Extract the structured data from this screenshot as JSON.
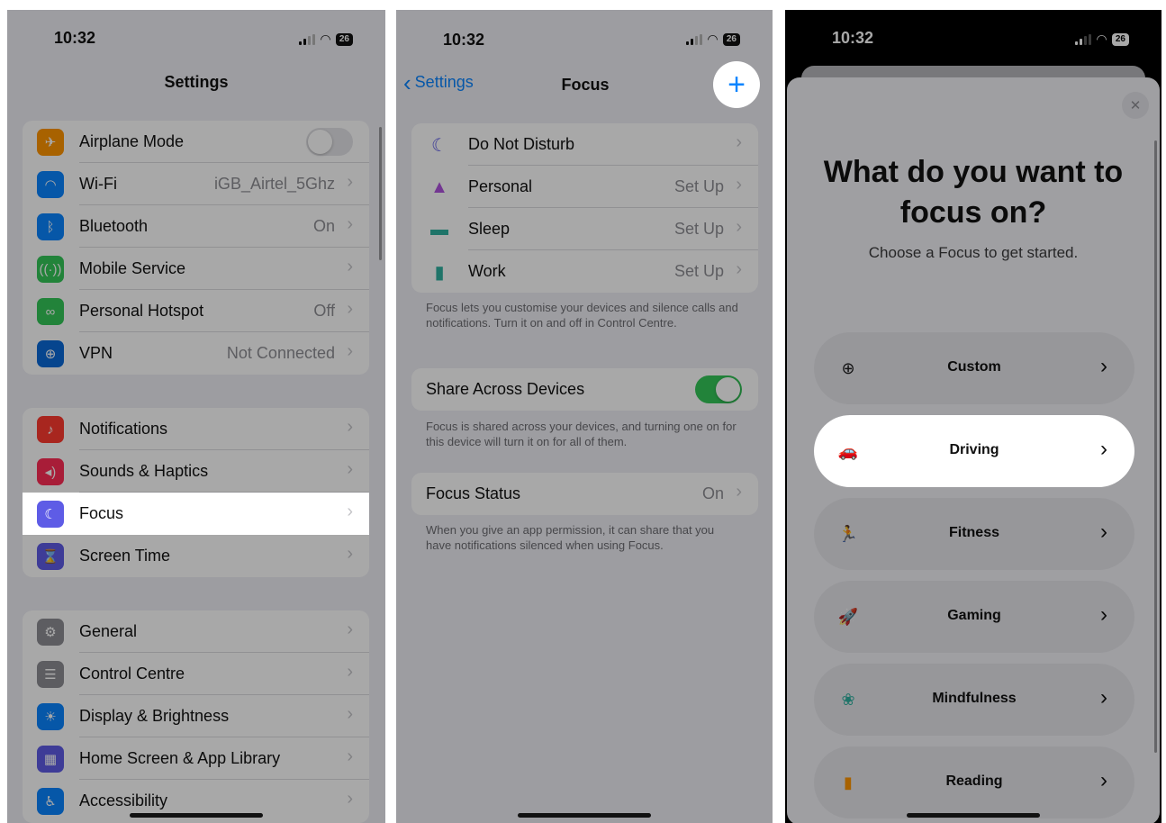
{
  "screen1": {
    "time": "10:32",
    "battery": "26",
    "title": "Settings",
    "group1": [
      {
        "label": "Airplane Mode",
        "value": "",
        "icon": "airplane-icon",
        "color": "#ff9500",
        "glyph": "✈",
        "toggle": true
      },
      {
        "label": "Wi-Fi",
        "value": "iGB_Airtel_5Ghz",
        "icon": "wifi-icon",
        "color": "#0a84ff",
        "glyph": "◠"
      },
      {
        "label": "Bluetooth",
        "value": "On",
        "icon": "bluetooth-icon",
        "color": "#0a84ff",
        "glyph": "ᛒ"
      },
      {
        "label": "Mobile Service",
        "value": "",
        "icon": "antenna-icon",
        "color": "#34c759",
        "glyph": "((·))"
      },
      {
        "label": "Personal Hotspot",
        "value": "Off",
        "icon": "hotspot-icon",
        "color": "#34c759",
        "glyph": "∞"
      },
      {
        "label": "VPN",
        "value": "Not Connected",
        "icon": "globe-icon",
        "color": "#0a6ad8",
        "glyph": "⊕"
      }
    ],
    "group2": [
      {
        "label": "Notifications",
        "icon": "bell-icon",
        "color": "#ff3b30",
        "glyph": "♪"
      },
      {
        "label": "Sounds & Haptics",
        "icon": "speaker-icon",
        "color": "#ff2d55",
        "glyph": "◂)"
      },
      {
        "label": "Focus",
        "icon": "moon-icon",
        "color": "#5e5ce6",
        "glyph": "☾"
      },
      {
        "label": "Screen Time",
        "icon": "hourglass-icon",
        "color": "#5e5ce6",
        "glyph": "⌛"
      }
    ],
    "group3": [
      {
        "label": "General",
        "icon": "gear-icon",
        "color": "#8e8e93",
        "glyph": "⚙"
      },
      {
        "label": "Control Centre",
        "icon": "switches-icon",
        "color": "#8e8e93",
        "glyph": "☰"
      },
      {
        "label": "Display & Brightness",
        "icon": "sun-icon",
        "color": "#0a84ff",
        "glyph": "☀"
      },
      {
        "label": "Home Screen & App Library",
        "icon": "apps-grid-icon",
        "color": "#5e5ce6",
        "glyph": "▦"
      },
      {
        "label": "Accessibility",
        "icon": "accessibility-icon",
        "color": "#0a84ff",
        "glyph": "♿"
      }
    ]
  },
  "screen2": {
    "time": "10:32",
    "battery": "26",
    "back_label": "Settings",
    "title": "Focus",
    "add_glyph": "+",
    "modes": [
      {
        "label": "Do Not Disturb",
        "value": "",
        "icon": "moon-icon",
        "color": "#5e5ce6",
        "glyph": "☾"
      },
      {
        "label": "Personal",
        "value": "Set Up",
        "icon": "person-icon",
        "color": "#af52de",
        "glyph": "▲"
      },
      {
        "label": "Sleep",
        "value": "Set Up",
        "icon": "bed-icon",
        "color": "#30b0a0",
        "glyph": "▬"
      },
      {
        "label": "Work",
        "value": "Set Up",
        "icon": "badge-icon",
        "color": "#30b0a0",
        "glyph": "▮"
      }
    ],
    "footnote1": "Focus lets you customise your devices and silence calls and notifications. Turn it on and off in Control Centre.",
    "share_label": "Share Across Devices",
    "share_on": true,
    "footnote2": "Focus is shared across your devices, and turning one on for this device will turn it on for all of them.",
    "status_label": "Focus Status",
    "status_value": "On",
    "footnote3": "When you give an app permission, it can share that you have notifications silenced when using Focus."
  },
  "screen3": {
    "time": "10:32",
    "battery": "26",
    "close_glyph": "✕",
    "heading": "What do you want to focus on?",
    "subheading": "Choose a Focus to get started.",
    "options": [
      {
        "label": "Custom",
        "icon": "plus-circle-icon",
        "color": "#1c1c1e",
        "glyph": "⊕"
      },
      {
        "label": "Driving",
        "icon": "car-icon",
        "color": "#5e5ce6",
        "glyph": "🚗"
      },
      {
        "label": "Fitness",
        "icon": "running-icon",
        "color": "#34c759",
        "glyph": "🏃"
      },
      {
        "label": "Gaming",
        "icon": "rocket-icon",
        "color": "#0a84ff",
        "glyph": "🚀"
      },
      {
        "label": "Mindfulness",
        "icon": "flower-icon",
        "color": "#30b0a0",
        "glyph": "❀"
      },
      {
        "label": "Reading",
        "icon": "book-icon",
        "color": "#ff9500",
        "glyph": "▮"
      }
    ]
  }
}
